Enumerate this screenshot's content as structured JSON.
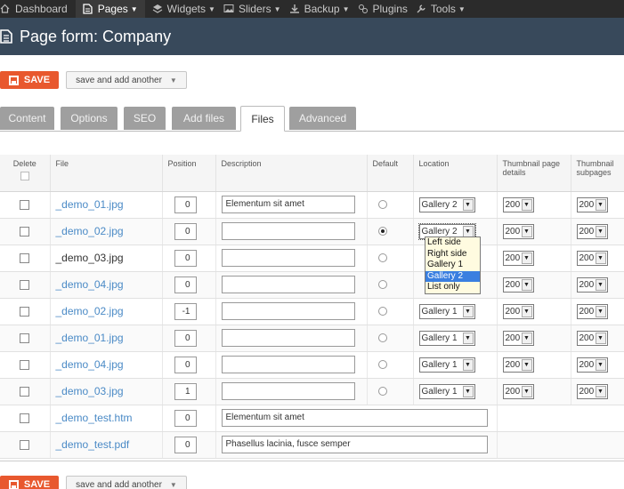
{
  "topnav": {
    "items": [
      {
        "label": "Dashboard",
        "icon": "home-icon",
        "caret": false,
        "active": false
      },
      {
        "label": "Pages",
        "icon": "page-icon",
        "caret": true,
        "active": true
      },
      {
        "label": "Widgets",
        "icon": "widgets-icon",
        "caret": true,
        "active": false
      },
      {
        "label": "Sliders",
        "icon": "image-icon",
        "caret": true,
        "active": false
      },
      {
        "label": "Backup",
        "icon": "download-icon",
        "caret": true,
        "active": false
      },
      {
        "label": "Plugins",
        "icon": "plugins-icon",
        "caret": false,
        "active": false
      },
      {
        "label": "Tools",
        "icon": "wrench-icon",
        "caret": true,
        "active": false
      }
    ]
  },
  "header": {
    "title": "Page form: Company"
  },
  "toolbar": {
    "save_label": "SAVE",
    "another_label": "save and add another"
  },
  "tabs": [
    "Content",
    "Options",
    "SEO",
    "Add files",
    "Files",
    "Advanced"
  ],
  "active_tab": "Files",
  "table": {
    "columns": {
      "delete": "Delete",
      "file": "File",
      "position": "Position",
      "description": "Description",
      "default": "Default",
      "location": "Location",
      "thumb_details": "Thumbnail page details",
      "thumb_subpages": "Thumbnail subpages"
    },
    "rows": [
      {
        "file": "_demo_01.jpg",
        "link": true,
        "position": "0",
        "description": "Elementum sit amet",
        "default": false,
        "location": "Gallery 2",
        "thumb1": "200",
        "thumb2": "200"
      },
      {
        "file": "_demo_02.jpg",
        "link": true,
        "position": "0",
        "description": "",
        "default": true,
        "location": "Gallery 2",
        "thumb1": "200",
        "thumb2": "200"
      },
      {
        "file": "_demo_03.jpg",
        "link": false,
        "position": "0",
        "description": "",
        "default": false,
        "location": "",
        "thumb1": "200",
        "thumb2": "200"
      },
      {
        "file": "_demo_04.jpg",
        "link": true,
        "position": "0",
        "description": "",
        "default": false,
        "location": "",
        "thumb1": "200",
        "thumb2": "200"
      },
      {
        "file": "_demo_02.jpg",
        "link": true,
        "position": "-1",
        "description": "",
        "default": false,
        "location": "Gallery 1",
        "thumb1": "200",
        "thumb2": "200"
      },
      {
        "file": "_demo_01.jpg",
        "link": true,
        "position": "0",
        "description": "",
        "default": false,
        "location": "Gallery 1",
        "thumb1": "200",
        "thumb2": "200"
      },
      {
        "file": "_demo_04.jpg",
        "link": true,
        "position": "0",
        "description": "",
        "default": false,
        "location": "Gallery 1",
        "thumb1": "200",
        "thumb2": "200"
      },
      {
        "file": "_demo_03.jpg",
        "link": true,
        "position": "1",
        "description": "",
        "default": false,
        "location": "Gallery 1",
        "thumb1": "200",
        "thumb2": "200"
      },
      {
        "file": "_demo_test.htm",
        "link": true,
        "position": "0",
        "description": "Elementum sit amet"
      },
      {
        "file": "_demo_test.pdf",
        "link": true,
        "position": "0",
        "description": "Phasellus lacinia, fusce semper"
      }
    ]
  },
  "location_dropdown": {
    "options": [
      "Left side",
      "Right side",
      "Gallery 1",
      "Gallery 2",
      "List only"
    ],
    "highlighted": "Gallery 2"
  }
}
